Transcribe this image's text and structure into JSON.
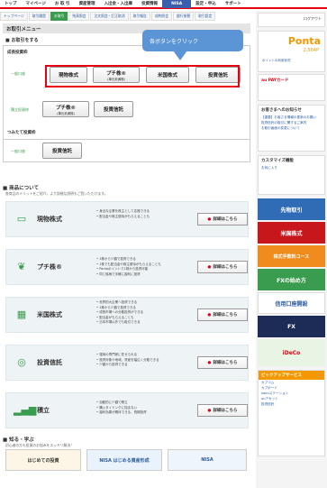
{
  "nav": {
    "items": [
      "トップ",
      "マイページ",
      "お 取 引",
      "資産管理",
      "入出金・入出庫",
      "投資情報",
      "NISA",
      "設定・申込",
      "サポート"
    ]
  },
  "subnav": {
    "items": [
      "トップページ",
      "取引履歴",
      "お取引",
      "残高照会",
      "注文照会・訂正取消",
      "取引報告",
      "成約照会",
      "銀行振替",
      "取引設定"
    ],
    "active_index": 2
  },
  "main": {
    "menu_title": "お取引メニュー",
    "trade_section": "■ お取引をする",
    "growth_label": "成長投資枠",
    "row_general": "一般口座",
    "row_specific": "積立投資枠",
    "buttons_row1": [
      {
        "label": "現物株式",
        "sub": ""
      },
      {
        "label": "プチ株®",
        "sub": "(単元未満株)"
      },
      {
        "label": "米国株式",
        "sub": ""
      },
      {
        "label": "投資信託",
        "sub": ""
      }
    ],
    "buttons_row2": [
      {
        "label": "プチ株®",
        "sub": "(単元未満株)"
      },
      {
        "label": "投資信託",
        "sub": ""
      }
    ],
    "tsumitate_label": "つみたて投資枠",
    "buttons_row3": [
      {
        "label": "投資信託",
        "sub": ""
      }
    ],
    "callout": "各ボタンをクリック"
  },
  "products": {
    "title": "■ 商品について",
    "desc": "各商品のメリットをご紹介。より詳細な説明もご覧いただけます。",
    "detail_label": "詳細はこちら",
    "items": [
      {
        "name": "現物株式",
        "icon": "ticket-icon",
        "points": [
          "身近な企業を株主として応援できる",
          "配当金や株主優待がもらえることも"
        ]
      },
      {
        "name": "プチ株®",
        "icon": "sprout-icon",
        "points": [
          "1株から少額で投資できる",
          "1株でも配当金や株主優待がもらえることも",
          "Pontaポイントで1株から投資可能",
          "同じ銘柄で手軽に複利に投資"
        ]
      },
      {
        "name": "米国株式",
        "icon": "flag-icon",
        "points": [
          "世界的大企業へ投資できる",
          "1株から少額で投資できる",
          "成長市場への分散投資ができる",
          "配当金がもらえることも",
          "日本市場以外でも取引できる"
        ]
      },
      {
        "name": "投資信託",
        "icon": "coins-icon",
        "points": [
          "運用の専門家に任せられる",
          "投資対象や地域、資産を幅広く分散できる",
          "少額から投資できる"
        ]
      },
      {
        "name": "積立",
        "icon": "chart-bars-icon",
        "points": [
          "自動的に少額で積立",
          "購入タイミングに悩まない",
          "複利効果が期待できる、長期投資"
        ]
      }
    ]
  },
  "learn": {
    "title": "■ 知る・学ぶ",
    "desc": "初心者の方も投資のお悩みをスッキリ解決！",
    "banners": [
      "はじめての投資",
      "NISA はじめる資産形成",
      "NISA"
    ]
  },
  "sidebar": {
    "logout": "ログアウト",
    "ponta_logo": "Ponta",
    "ponta_points": "2,564P",
    "ponta_note": "ポイントの利用状況",
    "aupay": "au PAYカード",
    "notice_title": "お客さまへのお知らせ",
    "notices": [
      "【重要】お客さま情報の更新のお願い",
      "投資信託の取引に関するご案内",
      "お取引画面の変更について"
    ],
    "custom": "カスタマイズ機能",
    "fav": "お気に入り",
    "ads": [
      "先物取引",
      "米国株式",
      "株式手数料コース",
      "FXの始め方",
      "信用口座開設",
      "FX",
      "iDeCo"
    ],
    "pickup": "ピックアップサービス",
    "pickup_items": [
      "カブコム",
      "カブボード",
      "kabuステーション",
      "auアセット",
      "投資信託"
    ]
  }
}
